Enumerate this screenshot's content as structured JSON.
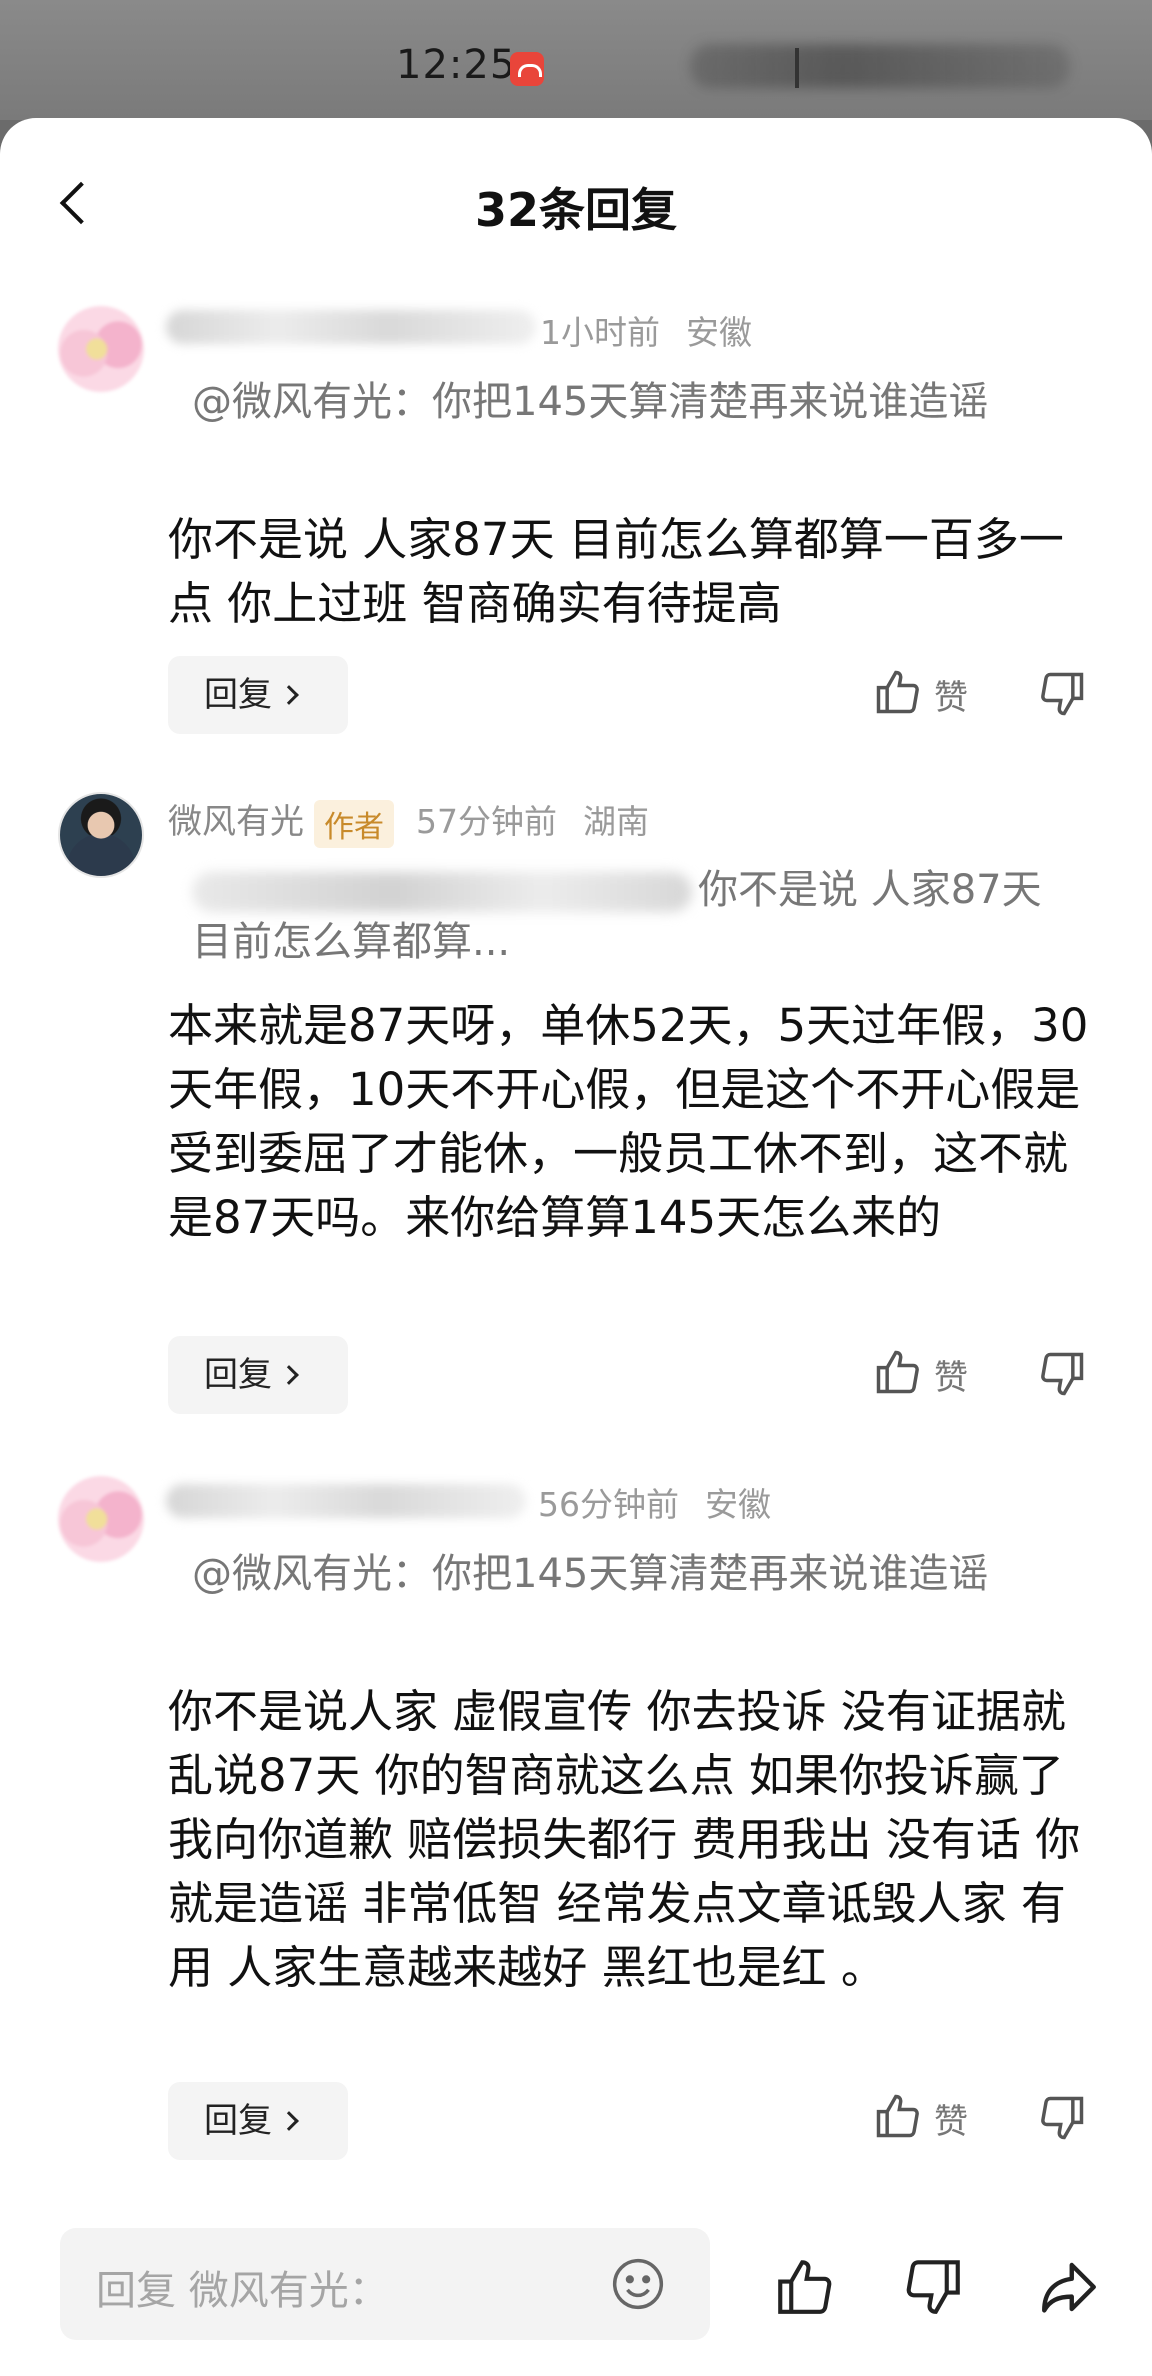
{
  "status_bar": {
    "time": "12:25"
  },
  "header": {
    "title": "32条回复"
  },
  "comments": [
    {
      "author_name_visible": "",
      "time": "1小时前",
      "region": "安徽",
      "quote_text": "@微风有光：你把145天算清楚再来说谁造谣",
      "body": "你不是说 人家87天 目前怎么算都算一百多一点 你上过班 智商确实有待提高",
      "reply_label": "回复",
      "like_label": "赞"
    },
    {
      "author_name_visible": "微风有光",
      "author_tag": "作者",
      "time": "57分钟前",
      "region": "湖南",
      "quote_text": "你不是说 人家87天 目前怎么算都算...",
      "body": "本来就是87天呀，单休52天，5天过年假，30天年假，10天不开心假，但是这个不开心假是受到委屈了才能休，一般员工休不到，这不就是87天吗。来你给算算145天怎么来的",
      "reply_label": "回复",
      "like_label": "赞"
    },
    {
      "author_name_visible": "",
      "time": "56分钟前",
      "region": "安徽",
      "quote_text": "@微风有光：你把145天算清楚再来说谁造谣",
      "body": "你不是说人家 虚假宣传 你去投诉 没有证据就乱说87天 你的智商就这么点 如果你投诉赢了 我向你道歉 赔偿损失都行 费用我出 没有话 你就是造谣 非常低智 经常发点文章诋毁人家 有用 人家生意越来越好 黑红也是红 。",
      "reply_label": "回复",
      "like_label": "赞"
    }
  ],
  "footer": {
    "input_placeholder": "回复 微风有光："
  },
  "icons": {
    "back": "chevron-left-icon",
    "like": "thumbs-up-icon",
    "dislike": "thumbs-down-icon",
    "emoji": "smiley-icon",
    "share": "share-arrow-icon"
  },
  "colors": {
    "author_tag_text": "#c88a2a",
    "author_tag_bg": "#fbf0dd",
    "meta_text": "#9a9a9a"
  }
}
